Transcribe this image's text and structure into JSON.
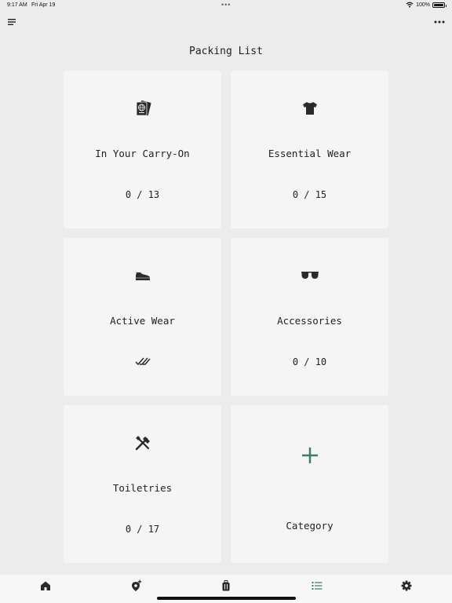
{
  "status_bar": {
    "time": "9:17 AM",
    "date": "Fri Apr 19",
    "battery": "100%"
  },
  "header": {
    "title": "Packing List"
  },
  "categories": [
    {
      "label": "In Your Carry-On",
      "count": "0 / 13",
      "icon": "passport-icon"
    },
    {
      "label": "Essential Wear",
      "count": "0 / 15",
      "icon": "tshirt-icon"
    },
    {
      "label": "Active Wear",
      "status": "complete",
      "icon": "sneaker-icon",
      "status_icon": "double-check-icon"
    },
    {
      "label": "Accessories",
      "count": "0 / 10",
      "icon": "sunglasses-icon"
    },
    {
      "label": "Toiletries",
      "count": "0 / 17",
      "icon": "toothbrush-icon"
    }
  ],
  "add_category": {
    "label": "Category",
    "icon": "plus-icon"
  },
  "tab_bar": {
    "tabs": [
      "home-icon",
      "map-pin-plus-icon",
      "luggage-icon",
      "list-icon",
      "settings-icon"
    ],
    "active": "list-icon"
  },
  "colors": {
    "accent": "#3f7a6a",
    "background": "#ececec",
    "card": "#f5f5f5",
    "icon": "#2a2a2a"
  }
}
